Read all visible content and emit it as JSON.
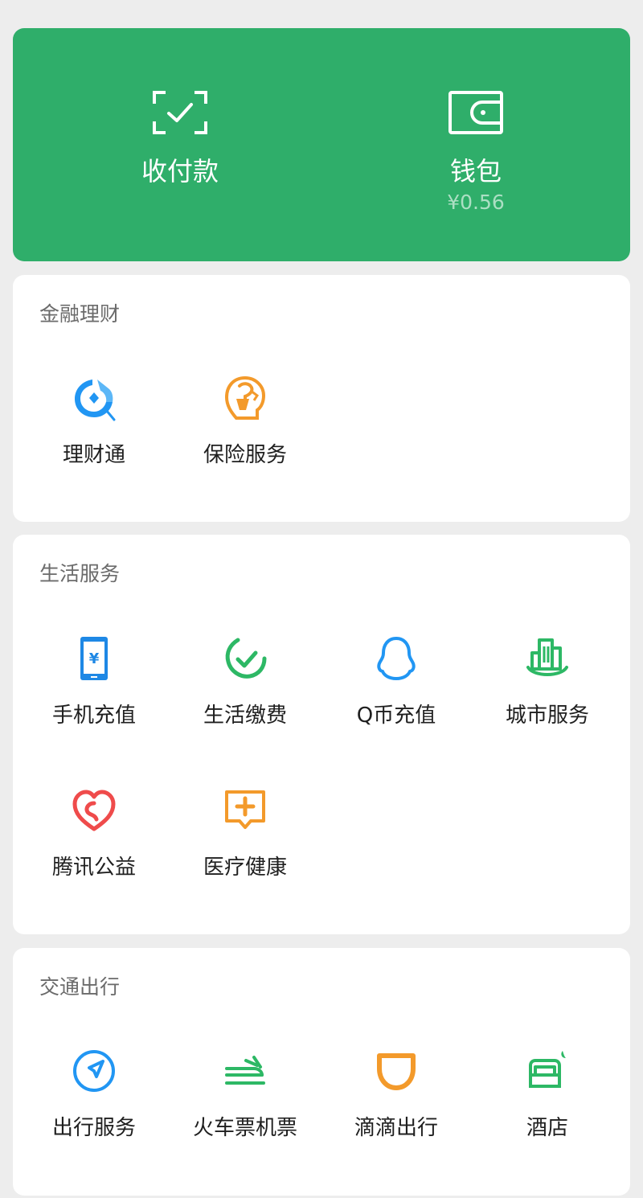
{
  "banner": {
    "pay": {
      "label": "收付款",
      "icon": "scan-check-icon"
    },
    "wallet": {
      "label": "钱包",
      "balance": "¥0.56",
      "icon": "wallet-icon"
    }
  },
  "finance": {
    "title": "金融理财",
    "items": [
      {
        "label": "理财通",
        "icon": "licaitong-icon",
        "color": "#2196f3"
      },
      {
        "label": "保险服务",
        "icon": "insurance-icon",
        "color": "#f39a2b"
      }
    ]
  },
  "life": {
    "title": "生活服务",
    "items": [
      {
        "label": "手机充值",
        "icon": "phone-recharge-icon",
        "color": "#1e88e5"
      },
      {
        "label": "生活缴费",
        "icon": "utility-bill-icon",
        "color": "#2db865"
      },
      {
        "label": "Q币充值",
        "icon": "qq-coin-icon",
        "color": "#2196f3"
      },
      {
        "label": "城市服务",
        "icon": "city-service-icon",
        "color": "#2db865"
      },
      {
        "label": "腾讯公益",
        "icon": "charity-heart-icon",
        "color": "#ef4b4b"
      },
      {
        "label": "医疗健康",
        "icon": "medical-health-icon",
        "color": "#f39a2b"
      }
    ]
  },
  "transport": {
    "title": "交通出行",
    "items": [
      {
        "label": "出行服务",
        "icon": "navigation-icon",
        "color": "#2196f3"
      },
      {
        "label": "火车票机票",
        "icon": "train-plane-icon",
        "color": "#2db865"
      },
      {
        "label": "滴滴出行",
        "icon": "didi-icon",
        "color": "#f39a2b"
      },
      {
        "label": "酒店",
        "icon": "hotel-bed-icon",
        "color": "#2db865"
      }
    ]
  }
}
